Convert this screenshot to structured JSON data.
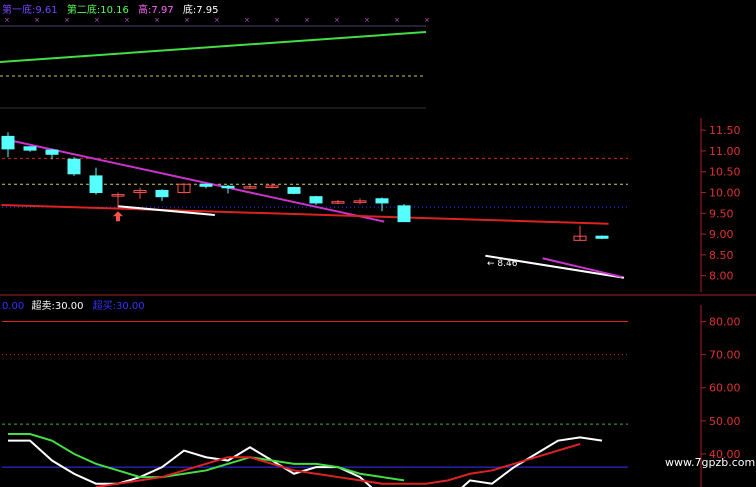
{
  "header": {
    "first_bottom_label": "第一底:",
    "first_bottom_value": "9.61",
    "second_bottom_label": "第二底:",
    "second_bottom_value": "10.16",
    "high_label": "高:",
    "high_value": "7.97",
    "bottom_label": "底:",
    "bottom_value": "7.95"
  },
  "indicator_header": {
    "lead_value": "0.00",
    "oversold_label": "超卖:",
    "oversold_value": "30.00",
    "overbought_label": "超买:",
    "overbought_value": "30.00"
  },
  "price_annotation": "← 8.46",
  "watermark": "www.7gpzb.com",
  "colors": {
    "bg": "#000000",
    "up": "#ff5050",
    "down": "#55ffff",
    "green": "#44dd44",
    "magenta": "#cc33cc",
    "red": "#dd2222",
    "white": "#ffffff",
    "blue": "#3333ff",
    "axis": "#aa2222",
    "label_text": "#dd3333",
    "yellow_dash": "#cccc55",
    "green_dash": "#44aa44"
  },
  "chart_data": [
    {
      "type": "candlestick",
      "y_axis_side": "right",
      "ylim": [
        7.8,
        11.6
      ],
      "yticks": [
        11.5,
        11.0,
        10.5,
        10.0,
        9.5,
        9.0,
        8.5,
        8.0
      ],
      "ytick_labels": [
        "11.50",
        "11.00",
        "10.50",
        "10.00",
        "9.50",
        "9.00",
        "8.50",
        "8.00"
      ],
      "candles": [
        {
          "i": 0,
          "o": 11.35,
          "c": 11.05,
          "h": 11.45,
          "l": 10.85
        },
        {
          "i": 1,
          "o": 11.1,
          "c": 11.02,
          "h": 11.12,
          "l": 10.98
        },
        {
          "i": 2,
          "o": 11.02,
          "c": 10.92,
          "h": 11.05,
          "l": 10.8
        },
        {
          "i": 3,
          "o": 10.8,
          "c": 10.45,
          "h": 10.85,
          "l": 10.4
        },
        {
          "i": 4,
          "o": 10.4,
          "c": 10.0,
          "h": 10.6,
          "l": 9.95
        },
        {
          "i": 5,
          "o": 9.95,
          "c": 9.95,
          "h": 10.0,
          "l": 9.62
        },
        {
          "i": 6,
          "o": 10.0,
          "c": 10.05,
          "h": 10.12,
          "l": 9.85
        },
        {
          "i": 7,
          "o": 10.05,
          "c": 9.9,
          "h": 10.08,
          "l": 9.8
        },
        {
          "i": 8,
          "o": 10.0,
          "c": 10.2,
          "h": 10.22,
          "l": 9.98
        },
        {
          "i": 9,
          "o": 10.2,
          "c": 10.15,
          "h": 10.22,
          "l": 10.1
        },
        {
          "i": 10,
          "o": 10.15,
          "c": 10.12,
          "h": 10.18,
          "l": 9.98
        },
        {
          "i": 11,
          "o": 10.12,
          "c": 10.14,
          "h": 10.18,
          "l": 10.1
        },
        {
          "i": 12,
          "o": 10.12,
          "c": 10.16,
          "h": 10.22,
          "l": 10.1
        },
        {
          "i": 13,
          "o": 10.12,
          "c": 9.98,
          "h": 10.14,
          "l": 9.96
        },
        {
          "i": 14,
          "o": 9.9,
          "c": 9.75,
          "h": 9.92,
          "l": 9.7
        },
        {
          "i": 15,
          "o": 9.75,
          "c": 9.78,
          "h": 9.82,
          "l": 9.72
        },
        {
          "i": 16,
          "o": 9.78,
          "c": 9.8,
          "h": 9.86,
          "l": 9.72
        },
        {
          "i": 17,
          "o": 9.85,
          "c": 9.75,
          "h": 9.88,
          "l": 9.55
        },
        {
          "i": 18,
          "o": 9.68,
          "c": 9.3,
          "h": 9.72,
          "l": 9.3
        },
        {
          "i": 26,
          "o": 8.85,
          "c": 8.95,
          "h": 9.2,
          "l": 8.85
        },
        {
          "i": 27,
          "o": 8.95,
          "c": 8.9,
          "h": 8.97,
          "l": 8.88
        }
      ],
      "lines": [
        {
          "name": "trend_magenta_1",
          "color": "magenta",
          "points": [
            [
              -0.3,
              11.3
            ],
            [
              17.1,
              9.3
            ]
          ]
        },
        {
          "name": "trend_red",
          "color": "red",
          "points": [
            [
              -0.3,
              9.7
            ],
            [
              27.3,
              9.25
            ]
          ]
        },
        {
          "name": "trend_white_1",
          "color": "white",
          "points": [
            [
              5.0,
              9.67
            ],
            [
              9.4,
              9.46
            ]
          ]
        },
        {
          "name": "trend_white_2",
          "color": "white",
          "points": [
            [
              21.7,
              8.48
            ],
            [
              28.0,
              7.95
            ]
          ]
        },
        {
          "name": "trend_magenta_2",
          "color": "magenta",
          "points": [
            [
              24.3,
              8.42
            ],
            [
              27.9,
              7.97
            ]
          ]
        }
      ],
      "hlines": [
        {
          "y": 10.2,
          "color": "yellow_dash",
          "style": "dash"
        },
        {
          "y": 9.65,
          "color": "blue",
          "style": "dot"
        },
        {
          "y": 10.82,
          "color": "red",
          "style": "dash"
        }
      ],
      "up_arrow_at": {
        "i": 5,
        "y": 9.55
      }
    },
    {
      "type": "line",
      "y_axis_side": "right",
      "ylim": [
        30,
        85
      ],
      "yticks": [
        80,
        70,
        60,
        50,
        40
      ],
      "ytick_labels": [
        "80.00",
        "70.00",
        "60.00",
        "50.00",
        "40.00"
      ],
      "hlines": [
        {
          "y": 80,
          "color": "red",
          "style": "solid"
        },
        {
          "y": 70,
          "color": "red",
          "style": "dot"
        },
        {
          "y": 49,
          "color": "green_dash",
          "style": "dash"
        },
        {
          "y": 36,
          "color": "blue",
          "style": "solid"
        }
      ],
      "series": [
        {
          "color": "white",
          "values": [
            [
              0,
              44
            ],
            [
              1,
              44
            ],
            [
              2,
              38
            ],
            [
              3,
              34
            ],
            [
              4,
              31
            ],
            [
              5,
              31
            ],
            [
              6,
              33
            ],
            [
              7,
              36
            ],
            [
              8,
              41
            ],
            [
              9,
              39
            ],
            [
              10,
              38
            ],
            [
              11,
              42
            ],
            [
              12,
              38
            ],
            [
              13,
              34
            ],
            [
              14,
              36
            ],
            [
              15,
              36
            ],
            [
              16,
              33
            ],
            [
              17,
              27
            ],
            [
              18,
              24
            ],
            [
              19,
              29
            ],
            [
              20,
              26
            ],
            [
              21,
              32
            ],
            [
              22,
              31
            ],
            [
              23,
              36
            ],
            [
              24,
              40
            ],
            [
              25,
              44
            ],
            [
              26,
              45
            ],
            [
              27,
              44
            ]
          ]
        },
        {
          "color": "green",
          "values": [
            [
              0,
              46
            ],
            [
              1,
              46
            ],
            [
              2,
              44
            ],
            [
              3,
              40
            ],
            [
              4,
              37
            ],
            [
              5,
              35
            ],
            [
              6,
              33
            ],
            [
              7,
              33
            ],
            [
              8,
              34
            ],
            [
              9,
              35
            ],
            [
              10,
              37
            ],
            [
              11,
              39
            ],
            [
              12,
              38
            ],
            [
              13,
              37
            ],
            [
              14,
              37
            ],
            [
              15,
              36
            ],
            [
              16,
              34
            ],
            [
              17,
              33
            ],
            [
              18,
              32
            ]
          ]
        },
        {
          "color": "red",
          "values": [
            [
              4,
              30
            ],
            [
              5,
              31
            ],
            [
              6,
              32
            ],
            [
              7,
              33
            ],
            [
              8,
              35
            ],
            [
              9,
              37
            ],
            [
              10,
              39
            ],
            [
              11,
              39
            ],
            [
              12,
              37
            ],
            [
              13,
              35
            ],
            [
              14,
              34
            ],
            [
              15,
              33
            ],
            [
              16,
              32
            ],
            [
              17,
              31
            ],
            [
              18,
              31
            ],
            [
              19,
              31
            ],
            [
              20,
              32
            ],
            [
              21,
              34
            ],
            [
              22,
              35
            ],
            [
              23,
              37
            ],
            [
              24,
              39
            ],
            [
              25,
              41
            ],
            [
              26,
              43
            ]
          ]
        }
      ]
    }
  ]
}
